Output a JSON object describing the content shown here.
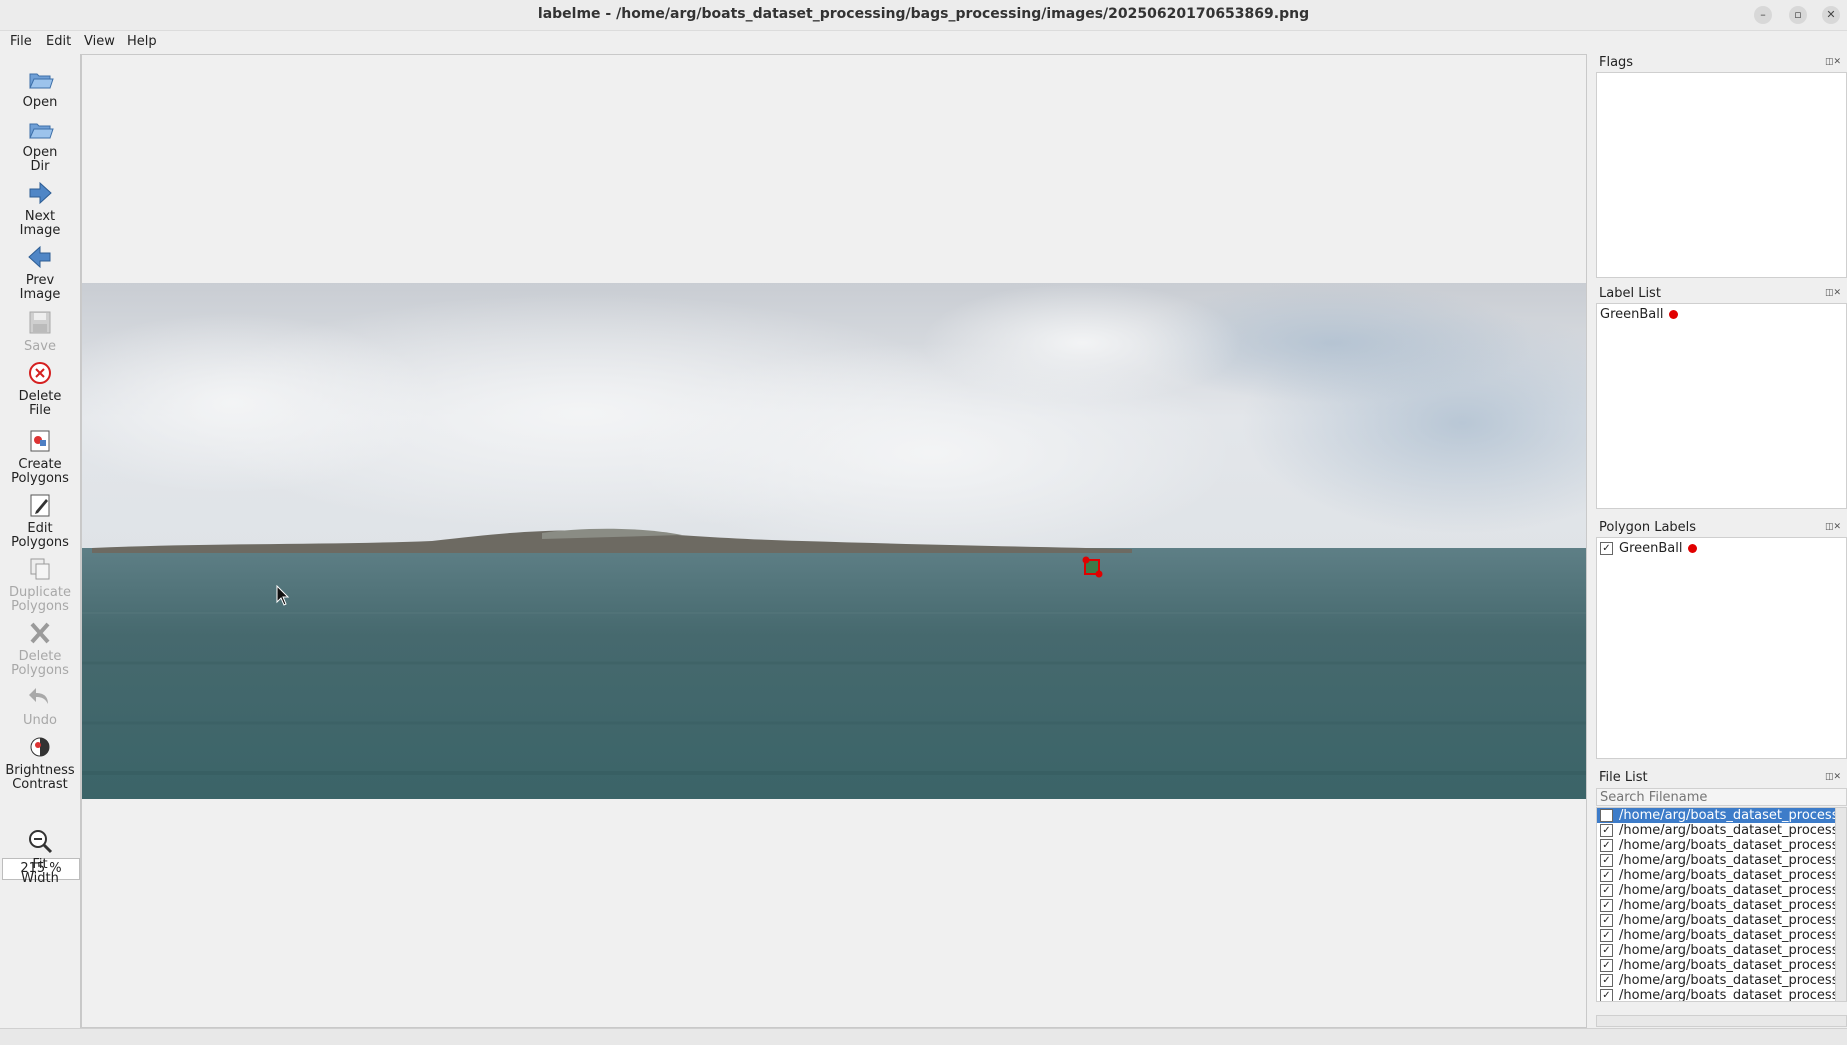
{
  "window": {
    "title": "labelme - /home/arg/boats_dataset_processing/bags_processing/images/20250620170653869.png",
    "controls": [
      "–",
      "▫",
      "✕"
    ]
  },
  "menu": [
    "File",
    "Edit",
    "View",
    "Help"
  ],
  "toolbar": {
    "open": "Open",
    "open_dir": "Open\nDir",
    "next_image": "Next\nImage",
    "prev_image": "Prev\nImage",
    "save": "Save",
    "delete_file": "Delete\nFile",
    "create_polygons": "Create\nPolygons",
    "edit_polygons": "Edit\nPolygons",
    "duplicate_polygons": "Duplicate\nPolygons",
    "delete_polygons": "Delete\nPolygons",
    "undo": "Undo",
    "brightness_contrast": "Brightness\nContrast",
    "zoom": "215 %",
    "fit_width": "Fit\nWidth"
  },
  "panels": {
    "flags": {
      "title": "Flags"
    },
    "label_list": {
      "title": "Label List",
      "items": [
        {
          "label": "GreenBall",
          "color": "#e10000"
        }
      ]
    },
    "polygon_labels": {
      "title": "Polygon Labels",
      "items": [
        {
          "label": "GreenBall",
          "checked": true,
          "color": "#e10000"
        }
      ]
    },
    "file_list": {
      "title": "File List",
      "search_placeholder": "Search Filename",
      "files": [
        "/home/arg/boats_dataset_processing",
        "/home/arg/boats_dataset_processing",
        "/home/arg/boats_dataset_processing",
        "/home/arg/boats_dataset_processing",
        "/home/arg/boats_dataset_processing",
        "/home/arg/boats_dataset_processing",
        "/home/arg/boats_dataset_processing",
        "/home/arg/boats_dataset_processing",
        "/home/arg/boats_dataset_processing",
        "/home/arg/boats_dataset_processing",
        "/home/arg/boats_dataset_processing",
        "/home/arg/boats_dataset_processing",
        "/home/arg/boats_dataset_processing"
      ]
    }
  },
  "colors": {
    "selection": "#3d7cc9",
    "polygon": "#e10000",
    "sea": "#3f6b6e",
    "sky": "#d3d8dd"
  }
}
